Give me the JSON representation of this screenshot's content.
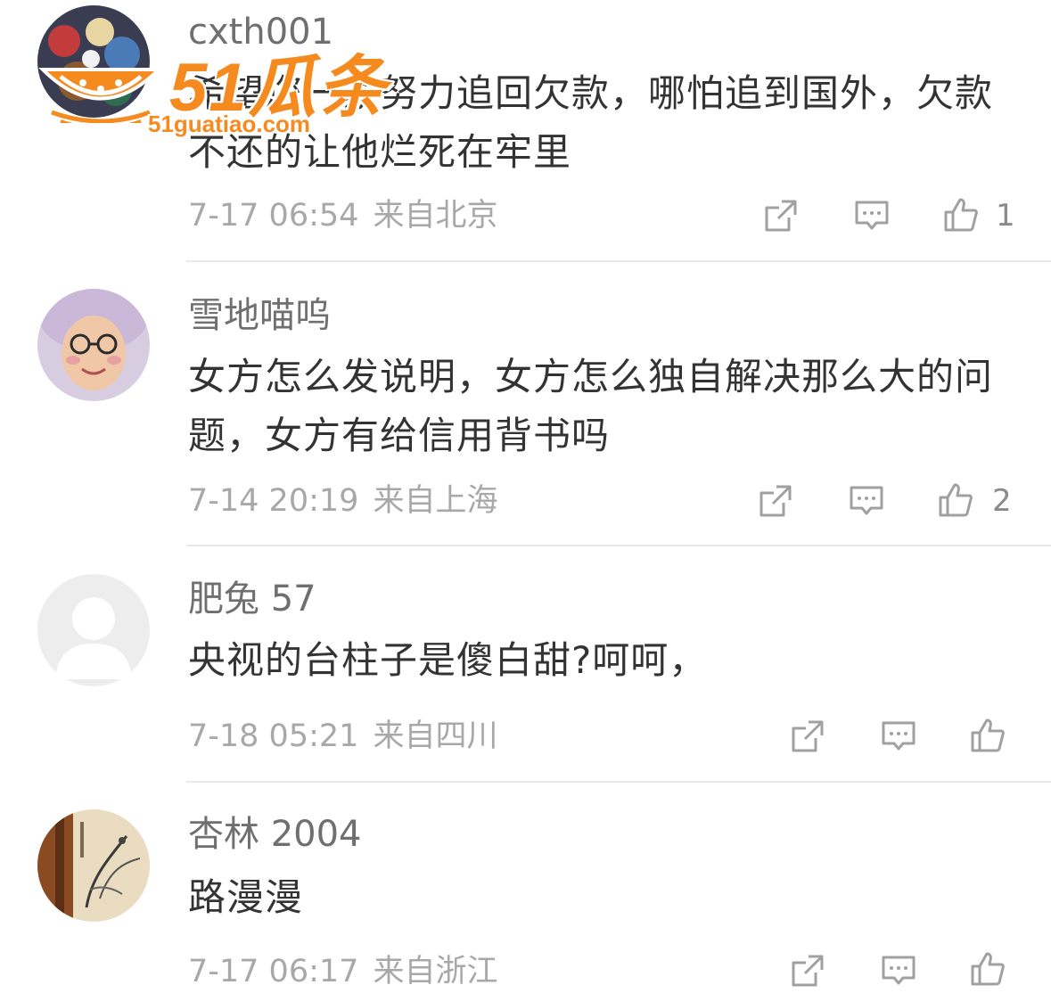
{
  "comments": [
    {
      "username": "cxth001",
      "text": "希望您一家努力追回欠款，哪怕追到国外，欠款不还的让他烂死在牢里",
      "date": "7-17 06:54",
      "location": "来自北京",
      "likes": "1",
      "avatar": "colorful-artwork"
    },
    {
      "username": "雪地喵呜",
      "text": "女方怎么发说明，女方怎么独自解决那么大的问题，女方有给信用背书吗",
      "date": "7-14 20:19",
      "location": "来自上海",
      "likes": "2",
      "avatar": "woman-with-glasses-purple-hat"
    },
    {
      "username": "肥兔 57",
      "text": "央视的台柱子是傻白甜?呵呵，",
      "date": "7-18 05:21",
      "location": "来自四川",
      "likes": "",
      "avatar": "default-user-placeholder"
    },
    {
      "username": "杏林 2004",
      "text": "路漫漫",
      "date": "7-17 06:17",
      "location": "来自浙江",
      "likes": "",
      "avatar": "chinese-ink-painting"
    }
  ],
  "watermark": {
    "title": "51瓜条",
    "url": "51guatiao.com"
  },
  "icons": {
    "share": "share-icon",
    "reply": "comment-icon",
    "like": "thumbs-up-icon"
  },
  "colors": {
    "username": "#6f6f6f",
    "text": "#333333",
    "meta": "#a8a8a8",
    "icon": "#a0a0a0",
    "divider": "#e8e8e8",
    "watermark": "#f58a1f"
  }
}
